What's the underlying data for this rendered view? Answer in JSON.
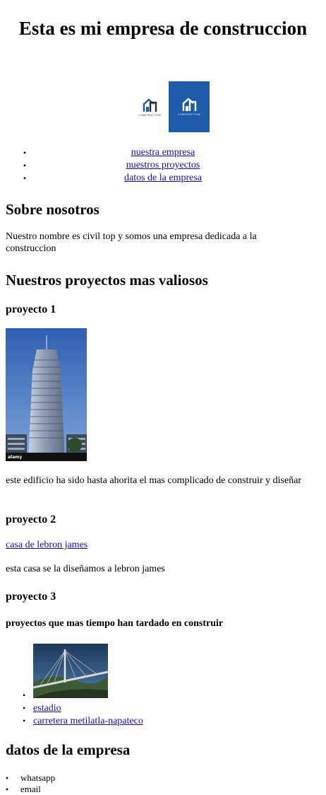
{
  "header": {
    "title": "Esta es mi empresa de construccion",
    "logo_caption": "CONSTRUCTION"
  },
  "nav": {
    "items": [
      {
        "label": "nuestra empresa"
      },
      {
        "label": "nuestros proyectos"
      },
      {
        "label": "datos de la empresa"
      }
    ]
  },
  "about": {
    "heading": "Sobre nosotros",
    "text": "Nuestro nombre es civil top y somos una empresa dedicada a la construccion"
  },
  "projects": {
    "heading": "Nuestros proyectos mas valiosos",
    "p1": {
      "title": "proyecto 1",
      "caption": "este edificio ha sido hasta ahorita el mas complicado de construir y diseñar",
      "watermark": "alamy"
    },
    "p2": {
      "title": "proyecto 2",
      "link": "casa de lebron james",
      "caption": "esta casa se la diseñamos a lebron james"
    },
    "p3": {
      "title": "proyecto 3",
      "subtitle": "proyectos que mas tiempo han tardado en construir",
      "list": [
        {
          "label": "estadio"
        },
        {
          "label": "carretera metilatla-napateco"
        }
      ]
    }
  },
  "company": {
    "heading": "datos de la empresa",
    "contacts": [
      {
        "label": "whatsapp"
      },
      {
        "label": "email"
      }
    ]
  },
  "colors": {
    "link": "#1a0dab",
    "logo_blue": "#1f5bab"
  }
}
